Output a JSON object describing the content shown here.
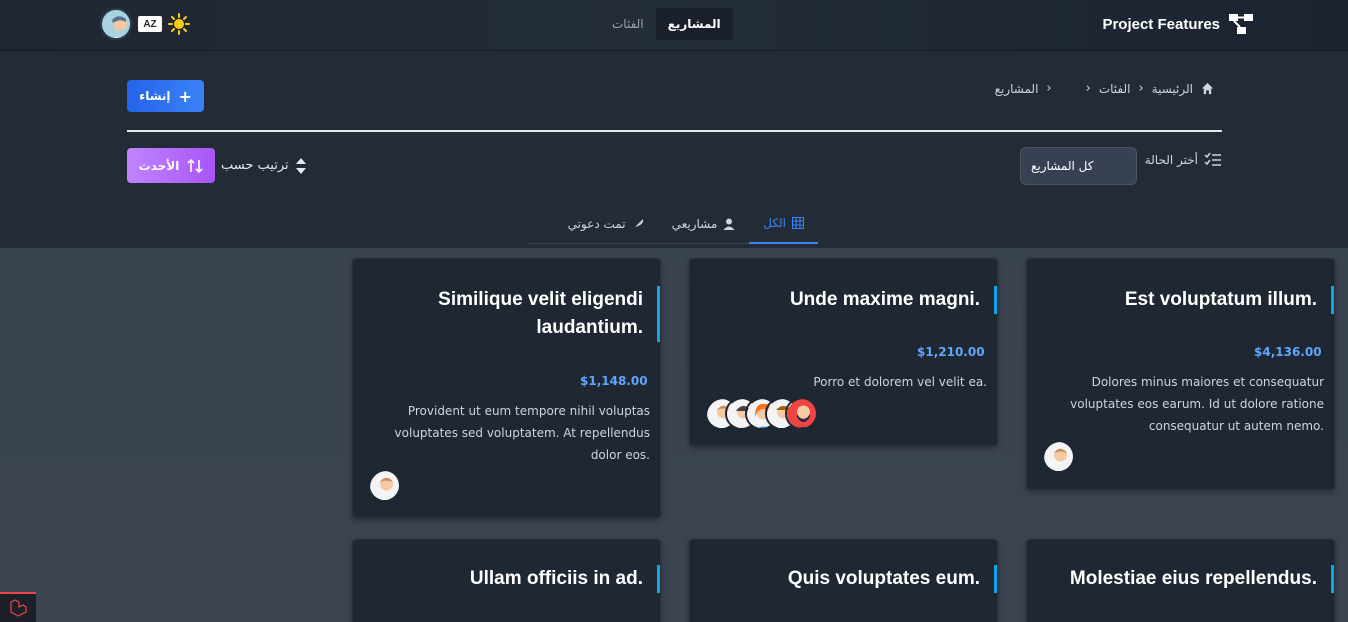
{
  "topbar": {
    "brand": "Project Features",
    "nav": [
      {
        "label": "المشاريع",
        "active": true
      },
      {
        "label": "الفئات",
        "active": false
      }
    ],
    "lang_label": "AZ"
  },
  "breadcrumb": {
    "home": "الرئيسية",
    "categories": "الفئات",
    "projects": "المشاريع"
  },
  "create_label": "إنشاء",
  "filter": {
    "label": "أختر الحالة",
    "value": "كل المشاريع"
  },
  "sort": {
    "label": "ترتيب حسب",
    "value": "الأحدث"
  },
  "tabs": [
    {
      "label": "الكل",
      "active": true
    },
    {
      "label": "مشاريعي",
      "active": false
    },
    {
      "label": "تمت دعوتي",
      "active": false
    }
  ],
  "cards": [
    {
      "title": "Est voluptatum illum.",
      "price": "$4,136.00",
      "desc": "Dolores minus maiores et consequatur voluptates eos earum. Id ut dolore ratione consequatur ut autem nemo.",
      "members": 1
    },
    {
      "title": "Unde maxime magni.",
      "price": "$1,210.00",
      "desc": "Porro et dolorem vel velit ea.",
      "members": 5
    },
    {
      "title": "Similique velit eligendi laudantium.",
      "price": "$1,148.00",
      "desc": "Provident ut eum tempore nihil voluptas voluptates sed voluptatem. At repellendus dolor eos.",
      "members": 1
    },
    {
      "title": "Molestiae eius repellendus.",
      "price": "",
      "desc": "",
      "members": 0
    },
    {
      "title": "Quis voluptates eum.",
      "price": "",
      "desc": "",
      "members": 0
    },
    {
      "title": "Ullam officiis in ad.",
      "price": "",
      "desc": "",
      "members": 0
    }
  ],
  "colors": {
    "accent": "#3b82f6",
    "title_bar": "#0ea5e9",
    "sort_button": "#a855f7"
  }
}
